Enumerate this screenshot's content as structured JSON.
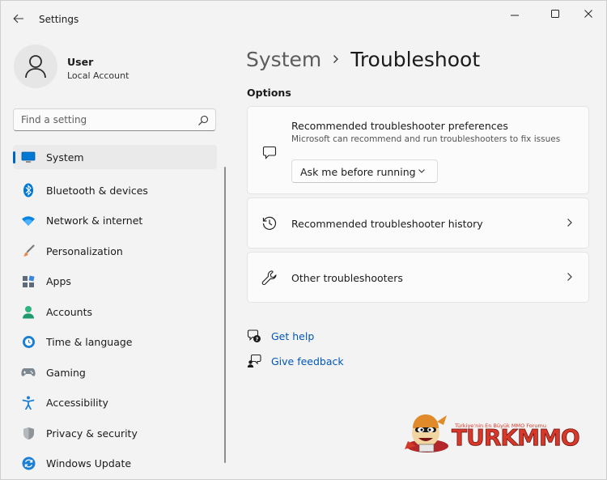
{
  "window": {
    "title": "Settings"
  },
  "profile": {
    "name": "User",
    "account_type": "Local Account"
  },
  "search": {
    "placeholder": "Find a setting"
  },
  "sidebar": {
    "items": [
      {
        "label": "System",
        "icon": "monitor-icon",
        "selected": true
      },
      {
        "label": "Bluetooth & devices",
        "icon": "bluetooth-icon"
      },
      {
        "label": "Network & internet",
        "icon": "wifi-icon"
      },
      {
        "label": "Personalization",
        "icon": "brush-icon"
      },
      {
        "label": "Apps",
        "icon": "apps-icon"
      },
      {
        "label": "Accounts",
        "icon": "person-icon"
      },
      {
        "label": "Time & language",
        "icon": "globe-clock-icon"
      },
      {
        "label": "Gaming",
        "icon": "gamepad-icon"
      },
      {
        "label": "Accessibility",
        "icon": "accessibility-icon"
      },
      {
        "label": "Privacy & security",
        "icon": "shield-icon"
      },
      {
        "label": "Windows Update",
        "icon": "update-icon"
      }
    ]
  },
  "breadcrumb": {
    "parent": "System",
    "current": "Troubleshoot"
  },
  "main": {
    "section_title": "Options",
    "cards": [
      {
        "title": "Recommended troubleshooter preferences",
        "subtitle": "Microsoft can recommend and run troubleshooters to fix issues",
        "dropdown_value": "Ask me before running",
        "icon": "chat-bubble-icon"
      },
      {
        "title": "Recommended troubleshooter history",
        "icon": "history-icon"
      },
      {
        "title": "Other troubleshooters",
        "icon": "wrench-icon"
      }
    ],
    "links": [
      {
        "label": "Get help",
        "icon": "help-icon"
      },
      {
        "label": "Give feedback",
        "icon": "feedback-icon"
      }
    ]
  },
  "watermark": {
    "tagline": "Türkiye'nin En Büyük MMO Forumu",
    "brand": "TURKMMO"
  },
  "colors": {
    "accent": "#0067c0",
    "link": "#0057b7",
    "background": "#f3f3f3",
    "card": "#fbfbfb"
  }
}
